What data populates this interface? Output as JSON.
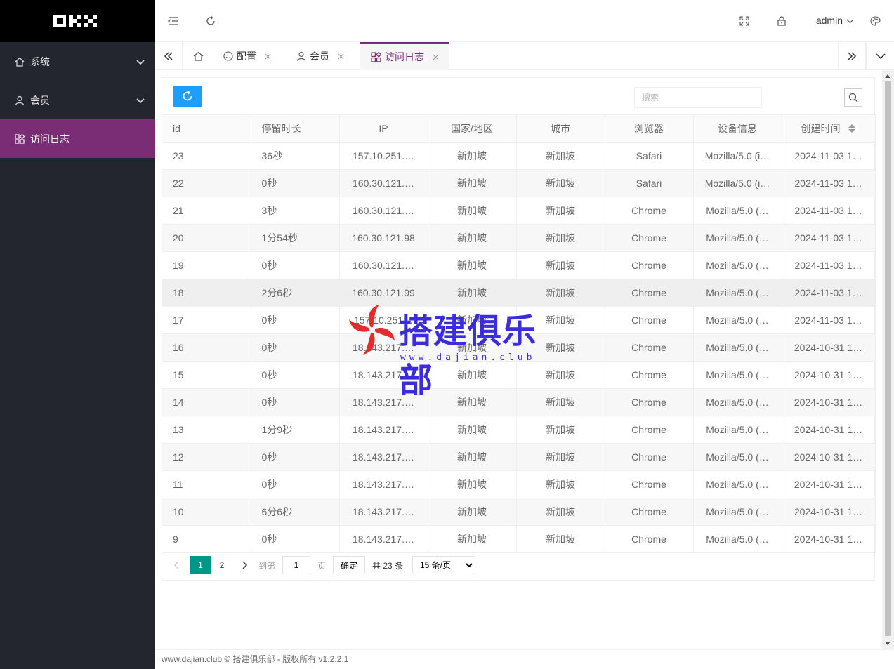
{
  "sidebar": {
    "items": [
      {
        "label": "系统",
        "icon": "home-icon"
      },
      {
        "label": "会员",
        "icon": "user-icon"
      },
      {
        "label": "访问日志",
        "icon": "apps-icon"
      }
    ]
  },
  "header": {
    "user": "admin"
  },
  "tabs": {
    "items": [
      {
        "label": "配置",
        "icon": "smile-icon"
      },
      {
        "label": "会员",
        "icon": "user-icon"
      },
      {
        "label": "访问日志",
        "icon": "apps-icon"
      }
    ]
  },
  "toolbar": {
    "search_placeholder": "搜索"
  },
  "table": {
    "columns": [
      "id",
      "停留时长",
      "IP",
      "国家/地区",
      "城市",
      "浏览器",
      "设备信息",
      "创建时间"
    ],
    "rows": [
      [
        "23",
        "36秒",
        "157.10.251.…",
        "新加坡",
        "新加坡",
        "Safari",
        "Mozilla/5.0 (i…",
        "2024-11-03 1…"
      ],
      [
        "22",
        "0秒",
        "160.30.121.…",
        "新加坡",
        "新加坡",
        "Safari",
        "Mozilla/5.0 (i…",
        "2024-11-03 1…"
      ],
      [
        "21",
        "3秒",
        "160.30.121.…",
        "新加坡",
        "新加坡",
        "Chrome",
        "Mozilla/5.0 (…",
        "2024-11-03 1…"
      ],
      [
        "20",
        "1分54秒",
        "160.30.121.98",
        "新加坡",
        "新加坡",
        "Chrome",
        "Mozilla/5.0 (…",
        "2024-11-03 1…"
      ],
      [
        "19",
        "0秒",
        "160.30.121.…",
        "新加坡",
        "新加坡",
        "Chrome",
        "Mozilla/5.0 (…",
        "2024-11-03 1…"
      ],
      [
        "18",
        "2分6秒",
        "160.30.121.99",
        "新加坡",
        "新加坡",
        "Chrome",
        "Mozilla/5.0 (…",
        "2024-11-03 1…"
      ],
      [
        "17",
        "0秒",
        "157.10.251…",
        "新加坡",
        "新加坡",
        "Chrome",
        "Mozilla/5.0 (…",
        "2024-11-03 1…"
      ],
      [
        "16",
        "0秒",
        "18.143.217.…",
        "新加坡",
        "新加坡",
        "Chrome",
        "Mozilla/5.0 (…",
        "2024-10-31 1…"
      ],
      [
        "15",
        "0秒",
        "18.143.217.…",
        "新加坡",
        "新加坡",
        "Chrome",
        "Mozilla/5.0 (…",
        "2024-10-31 1…"
      ],
      [
        "14",
        "0秒",
        "18.143.217.…",
        "新加坡",
        "新加坡",
        "Chrome",
        "Mozilla/5.0 (…",
        "2024-10-31 1…"
      ],
      [
        "13",
        "1分9秒",
        "18.143.217.…",
        "新加坡",
        "新加坡",
        "Chrome",
        "Mozilla/5.0 (…",
        "2024-10-31 1…"
      ],
      [
        "12",
        "0秒",
        "18.143.217.…",
        "新加坡",
        "新加坡",
        "Chrome",
        "Mozilla/5.0 (…",
        "2024-10-31 1…"
      ],
      [
        "11",
        "0秒",
        "18.143.217.…",
        "新加坡",
        "新加坡",
        "Chrome",
        "Mozilla/5.0 (…",
        "2024-10-31 1…"
      ],
      [
        "10",
        "6分6秒",
        "18.143.217.…",
        "新加坡",
        "新加坡",
        "Chrome",
        "Mozilla/5.0 (…",
        "2024-10-31 1…"
      ],
      [
        "9",
        "0秒",
        "18.143.217.…",
        "新加坡",
        "新加坡",
        "Chrome",
        "Mozilla/5.0 (…",
        "2024-10-31 1…"
      ]
    ]
  },
  "pager": {
    "page1": "1",
    "page2": "2",
    "goto_label": "到第",
    "goto_value": "1",
    "page_unit": "页",
    "confirm": "确定",
    "total": "共 23 条",
    "per_page": "15 条/页"
  },
  "watermark": {
    "title": "搭建俱乐部",
    "url": "www.dajian.club"
  },
  "footer": {
    "text": "www.dajian.club © 搭建俱乐部 - 版权所有 v1.2.2.1"
  },
  "colors": {
    "sidebar_bg": "#23262e",
    "active_purple": "#7a2d74",
    "refresh_blue": "#1e9fff",
    "pager_green": "#009688"
  }
}
